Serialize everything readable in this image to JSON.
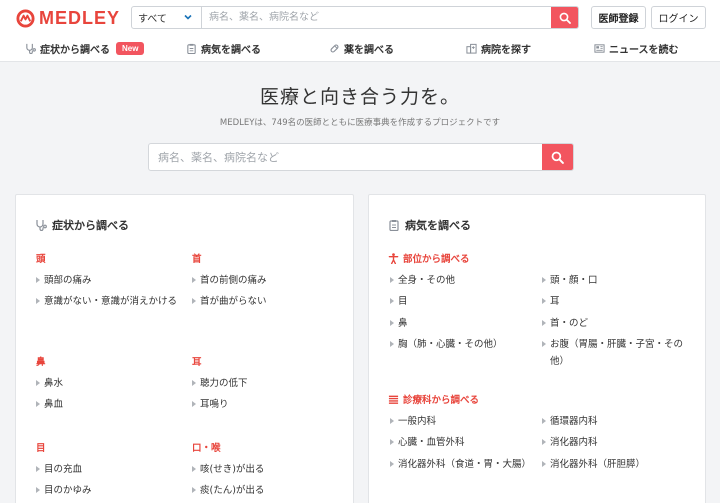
{
  "header": {
    "logo_text": "MEDLEY",
    "search_select": "すべて",
    "search_placeholder": "病名、薬名、病院名など",
    "register_label": "医師登録",
    "login_label": "ログイン"
  },
  "nav": {
    "symptoms": "症状から調べる",
    "new_badge": "New",
    "diseases": "病気を調べる",
    "drugs": "薬を調べる",
    "hospitals": "病院を探す",
    "news": "ニュースを読む"
  },
  "hero": {
    "title": "医療と向き合う力を。",
    "subtitle": "MEDLEYは、749名の医師とともに医療事典を作成するプロジェクトです",
    "search_placeholder": "病名、薬名、病院名など"
  },
  "symptoms_card": {
    "title": "症状から調べる",
    "groups": [
      {
        "name": "頭",
        "items": [
          "頭部の痛み",
          "意識がない・意識が消えかける"
        ]
      },
      {
        "name": "首",
        "items": [
          "首の前側の痛み",
          "首が曲がらない"
        ]
      },
      {
        "name": "鼻",
        "items": [
          "鼻水",
          "鼻血"
        ]
      },
      {
        "name": "耳",
        "items": [
          "聴力の低下",
          "耳鳴り"
        ]
      },
      {
        "name": "目",
        "items": [
          "目の充血",
          "目のかゆみ"
        ]
      },
      {
        "name": "口・喉",
        "items": [
          "咳(せき)が出る",
          "痰(たん)が出る"
        ]
      }
    ]
  },
  "diseases_card": {
    "title": "病気を調べる",
    "by_part": {
      "title": "部位から調べる",
      "items": [
        "全身・その他",
        "頭・顔・口",
        "目",
        "耳",
        "鼻",
        "首・のど",
        "胸（肺・心臓・その他）",
        "お腹（胃腸・肝臓・子宮・その他）"
      ]
    },
    "by_dept": {
      "title": "診療科から調べる",
      "items": [
        "一般内科",
        "循環器内科",
        "心臓・血管外科",
        "消化器内科",
        "消化器外科（食道・胃・大腸）",
        "消化器外科（肝胆膵）"
      ]
    }
  },
  "colors": {
    "brand": "#e8453c",
    "accent_button": "#f2555f"
  }
}
